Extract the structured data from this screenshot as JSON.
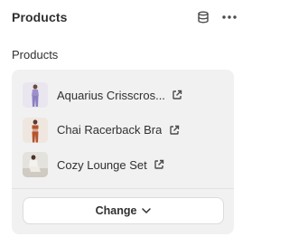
{
  "header": {
    "title": "Products"
  },
  "section": {
    "label": "Products"
  },
  "products": [
    {
      "name": "Aquarius Crisscros..."
    },
    {
      "name": "Chai Racerback Bra"
    },
    {
      "name": "Cozy Lounge Set"
    }
  ],
  "change_button": {
    "label": "Change"
  },
  "colors": {
    "card_bg": "#f1f1f1",
    "text": "#303030",
    "divider": "#e3e3e3"
  }
}
